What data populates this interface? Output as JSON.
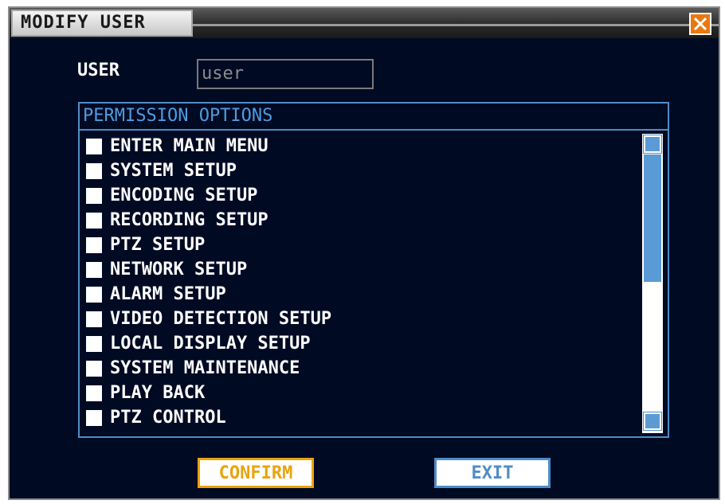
{
  "window": {
    "title": "MODIFY USER"
  },
  "user": {
    "label": "USER",
    "value": "user"
  },
  "permissions": {
    "header": "PERMISSION OPTIONS",
    "items": [
      {
        "label": "ENTER MAIN MENU",
        "checked": false
      },
      {
        "label": "SYSTEM SETUP",
        "checked": false
      },
      {
        "label": "ENCODING SETUP",
        "checked": false
      },
      {
        "label": "RECORDING SETUP",
        "checked": false
      },
      {
        "label": "PTZ SETUP",
        "checked": false
      },
      {
        "label": "NETWORK SETUP",
        "checked": false
      },
      {
        "label": "ALARM SETUP",
        "checked": false
      },
      {
        "label": "VIDEO DETECTION SETUP",
        "checked": false
      },
      {
        "label": "LOCAL DISPLAY SETUP",
        "checked": false
      },
      {
        "label": "SYSTEM MAINTENANCE",
        "checked": false
      },
      {
        "label": "PLAY BACK",
        "checked": false
      },
      {
        "label": "PTZ CONTROL",
        "checked": false
      }
    ]
  },
  "buttons": {
    "confirm": "CONFIRM",
    "exit": "EXIT"
  },
  "colors": {
    "background": "#000a23",
    "accent": "#4f8cc8",
    "confirm": "#e8a40f",
    "close": "#e8780f"
  },
  "icons": {
    "close": "close-icon"
  }
}
